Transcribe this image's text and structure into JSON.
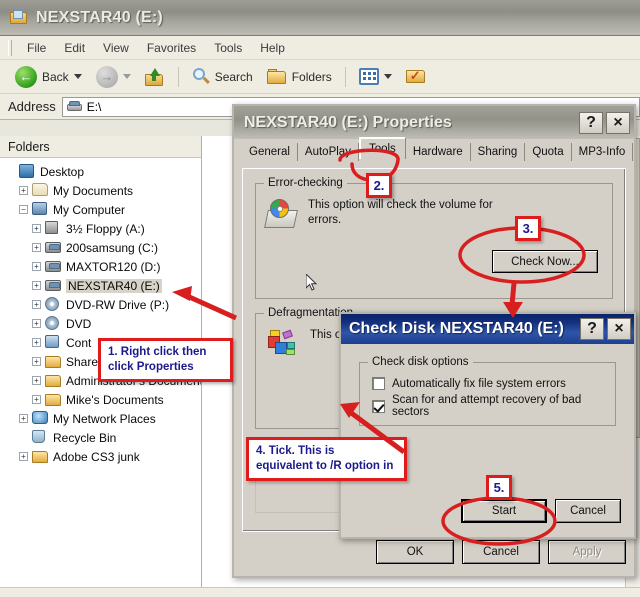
{
  "explorer": {
    "title": "NEXSTAR40 (E:)",
    "menus": [
      "File",
      "Edit",
      "View",
      "Favorites",
      "Tools",
      "Help"
    ],
    "toolbar": {
      "back_label": "Back",
      "search_label": "Search",
      "folders_label": "Folders"
    },
    "address": {
      "label": "Address",
      "value": "E:\\"
    },
    "folders_pane_title": "Folders",
    "tree": [
      {
        "label": "Desktop",
        "indent": 0,
        "expander": "none",
        "icon": "desktop-icon",
        "selected": false
      },
      {
        "label": "My Documents",
        "indent": 1,
        "expander": "plus",
        "icon": "mydocs-icon",
        "selected": false
      },
      {
        "label": "My Computer",
        "indent": 1,
        "expander": "minus",
        "icon": "computer-icon",
        "selected": false
      },
      {
        "label": "3½ Floppy (A:)",
        "indent": 2,
        "expander": "plus",
        "icon": "floppy-icon",
        "selected": false
      },
      {
        "label": "200samsung (C:)",
        "indent": 2,
        "expander": "plus",
        "icon": "harddisk-icon",
        "selected": false
      },
      {
        "label": "MAXTOR120 (D:)",
        "indent": 2,
        "expander": "plus",
        "icon": "harddisk-icon",
        "selected": false
      },
      {
        "label": "NEXSTAR40 (E:)",
        "indent": 2,
        "expander": "plus",
        "icon": "harddisk-icon",
        "selected": true
      },
      {
        "label": "DVD-RW Drive (P:)",
        "indent": 2,
        "expander": "plus",
        "icon": "dvd-icon",
        "selected": false
      },
      {
        "label": "DVD",
        "indent": 2,
        "expander": "plus",
        "icon": "dvd-icon",
        "selected": false
      },
      {
        "label": "Cont",
        "indent": 2,
        "expander": "plus",
        "icon": "control-panel-icon",
        "selected": false
      },
      {
        "label": "Shared Documents",
        "indent": 2,
        "expander": "plus",
        "icon": "folder-icon",
        "selected": false
      },
      {
        "label": "Administrator's Documents",
        "indent": 2,
        "expander": "plus",
        "icon": "folder-icon",
        "selected": false
      },
      {
        "label": "Mike's Documents",
        "indent": 2,
        "expander": "plus",
        "icon": "folder-icon",
        "selected": false
      },
      {
        "label": "My Network Places",
        "indent": 1,
        "expander": "plus",
        "icon": "network-icon",
        "selected": false
      },
      {
        "label": "Recycle Bin",
        "indent": 1,
        "expander": "none",
        "icon": "recycle-bin-icon",
        "selected": false
      },
      {
        "label": "Adobe CS3 junk",
        "indent": 1,
        "expander": "plus",
        "icon": "folder-icon",
        "selected": false
      }
    ]
  },
  "properties_dialog": {
    "title": "NEXSTAR40 (E:) Properties",
    "help_button": "?",
    "close_button": "×",
    "tabs": [
      {
        "label": "General",
        "active": false
      },
      {
        "label": "AutoPlay",
        "active": false
      },
      {
        "label": "Tools",
        "active": true
      },
      {
        "label": "Hardware",
        "active": false
      },
      {
        "label": "Sharing",
        "active": false
      },
      {
        "label": "Quota",
        "active": false
      },
      {
        "label": "MP3-Info",
        "active": false
      }
    ],
    "error_checking": {
      "group_label": "Error-checking",
      "description": "This option will check the volume for errors.",
      "button": "Check Now..."
    },
    "defragmentation": {
      "group_label": "Defragmentation",
      "description": "This op"
    },
    "buttons": {
      "ok": "OK",
      "cancel": "Cancel",
      "apply": "Apply"
    }
  },
  "check_disk_dialog": {
    "title": "Check Disk NEXSTAR40 (E:)",
    "help_button": "?",
    "close_button": "×",
    "options_group_label": "Check disk options",
    "options": [
      {
        "label": "Automatically fix file system errors",
        "checked": false
      },
      {
        "label": "Scan for and attempt recovery of bad sectors",
        "checked": true
      }
    ],
    "buttons": {
      "start": "Start",
      "cancel": "Cancel"
    }
  },
  "annotations": {
    "step1": {
      "line1": "1.  Right click then",
      "line2": "click Properties"
    },
    "step2": {
      "number": "2."
    },
    "step3": {
      "number": "3."
    },
    "step4": {
      "line1": "4.  Tick.  This is",
      "line2": "equivalent to /R option in"
    },
    "step5": {
      "number": "5."
    }
  },
  "colors": {
    "annotation_red": "#e01b1b",
    "annotation_text": "#1a1a8c",
    "active_title_blue": "#0a246a",
    "dialog_face": "#d4d0c8"
  }
}
